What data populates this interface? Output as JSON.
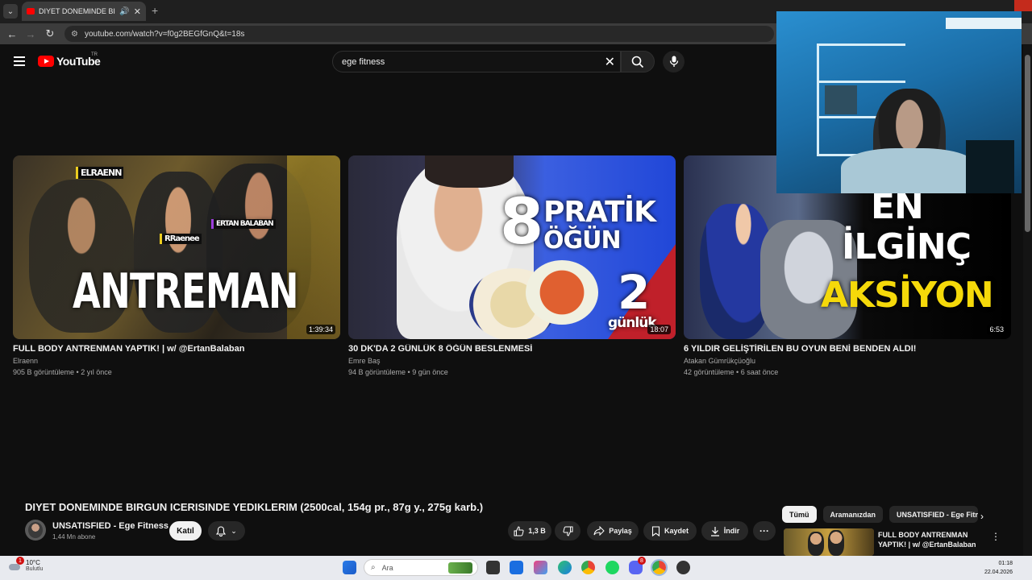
{
  "browser": {
    "tab_title": "DIYET DONEMINDE BIRGUN",
    "url": "youtube.com/watch?v=f0g2BEGfGnQ&t=18s"
  },
  "masthead": {
    "logo_text": "YouTube",
    "country_code": "TR",
    "search_value": "ege fitness"
  },
  "videos": [
    {
      "title": "FULL BODY ANTRENMAN YAPTIK! | w/ @ErtanBalaban",
      "channel": "Elraenn",
      "meta": "905 B görüntüleme • 2 yıl önce",
      "duration": "1:39:34",
      "thumb_text": [
        "ANTREMAN",
        "ELRAENN",
        "RRaenee",
        "ERTAN BALABAN"
      ]
    },
    {
      "title": "30 DK'DA 2 GÜNLÜK 8 ÖĞÜN BESLENMESİ",
      "channel": "Emre Baş",
      "meta": "94 B görüntüleme • 9 gün önce",
      "duration": "18:07",
      "thumb_text": [
        "8",
        "PRATİK",
        "ÖĞÜN",
        "2",
        "günlük"
      ]
    },
    {
      "title": "6 YILDIR GELİŞTİRİLEN BU OYUN BENİ BENDEN ALDI!",
      "channel": "Atakan Gümrükçüoğlu",
      "meta": "42 görüntüleme • 6 saat önce",
      "duration": "6:53",
      "thumb_text": [
        "EN",
        "İLGİNÇ",
        "AKSİYON"
      ]
    }
  ],
  "watch": {
    "title": "DIYET DONEMINDE BIRGUN ICERISINDE YEDIKLERIM (2500cal, 154g pr., 87g y., 275g karb.)",
    "channel_name": "UNSATISFIED - Ege Fitness",
    "subscribers": "1,44 Mn abone",
    "join_label": "Katıl",
    "like_count": "1,3 B",
    "share_label": "Paylaş",
    "save_label": "Kaydet",
    "download_label": "İndir"
  },
  "chips": [
    "Tümü",
    "Aramanızdan",
    "UNSATISFIED - Ege Fitne"
  ],
  "recommendation": {
    "title": "FULL BODY ANTRENMAN YAPTIK! | w/ @ErtanBalaban"
  },
  "taskbar": {
    "weather_temp": "10°C",
    "weather_desc": "Bulutlu",
    "weather_badge": "1",
    "search_placeholder": "Ara",
    "discord_badge": "8",
    "time": "01:18",
    "date": "22.04.2026"
  }
}
